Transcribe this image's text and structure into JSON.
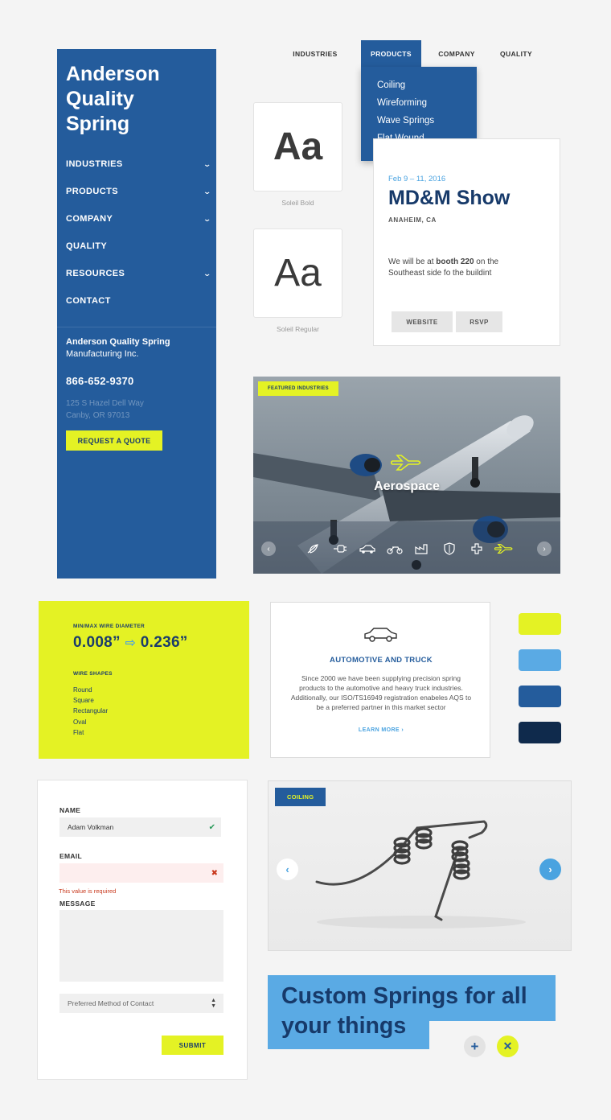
{
  "sidebar": {
    "logo_line1": "Anderson",
    "logo_line2": "Quality",
    "logo_line3": "Spring",
    "nav": [
      {
        "label": "INDUSTRIES",
        "chevron": "v"
      },
      {
        "label": "PRODUCTS",
        "chevron": "v"
      },
      {
        "label": "COMPANY",
        "chevron": "v"
      },
      {
        "label": "QUALITY",
        "chevron": ""
      },
      {
        "label": "RESOURCES",
        "chevron": "v"
      },
      {
        "label": "CONTACT",
        "chevron": ""
      }
    ],
    "company_line1": "Anderson Quality Spring",
    "company_line2": "Manufacturing Inc.",
    "phone": "866-652-9370",
    "address_line1": "125 S Hazel Dell Way",
    "address_line2": "Canby, OR 97013",
    "quote_button": "REQUEST A QUOTE"
  },
  "topnav": {
    "tabs": [
      "INDUSTRIES",
      "PRODUCTS",
      "COMPANY",
      "QUALITY"
    ],
    "active": "PRODUCTS",
    "dropdown": [
      "Coiling",
      "Wireforming",
      "Wave Springs",
      "Flat Wound"
    ]
  },
  "typography": [
    {
      "sample": "Aa",
      "label": "Soleil Bold"
    },
    {
      "sample": "Aa",
      "label": "Soleil Regular"
    }
  ],
  "event": {
    "date": "Feb 9 – 11, 2016",
    "title": "MD&M Show",
    "location": "ANAHEIM, CA",
    "desc_pre": "We will be at ",
    "desc_bold": "booth 220",
    "desc_post": " on the Southeast side fo the buildint",
    "website_button": "WEBSITE",
    "rsvp_button": "RSVP"
  },
  "featured": {
    "badge": "FEATURED INDUSTRIES",
    "caption": "Aerospace",
    "icons": [
      "feather-icon",
      "plug-icon",
      "car-icon",
      "motorcycle-icon",
      "factory-icon",
      "shield-icon",
      "medical-cross-icon",
      "airplane-icon"
    ],
    "active_icon": "airplane-icon"
  },
  "wire": {
    "diameter_label": "MIN/MAX WIRE DIAMETER",
    "min": "0.008”",
    "max": "0.236”",
    "shapes_label": "WIRE SHAPES",
    "shapes": [
      "Round",
      "Square",
      "Rectangular",
      "Oval",
      "Flat"
    ]
  },
  "automotive": {
    "icon": "car-icon",
    "title": "AUTOMOTIVE AND TRUCK",
    "text": "Since 2000 we have been supplying precision spring products to the automotive and heavy truck industries. Additionally, our ISO/TS16949 registration enabeles AQS to be a preferred partner in this market sector",
    "link": "LEARN MORE"
  },
  "palette": [
    "#e4f224",
    "#5aaae4",
    "#245c9c",
    "#0f2a4c"
  ],
  "form": {
    "name_label": "NAME",
    "name_value": "Adam Volkman",
    "email_label": "EMAIL",
    "email_value": "",
    "error": "This value is required",
    "message_label": "MESSAGE",
    "select_value": "Preferred Method of Contact",
    "submit": "SUBMIT"
  },
  "carousel": {
    "badge": "COILING"
  },
  "headline": {
    "text": "Custom Springs for all your things"
  }
}
